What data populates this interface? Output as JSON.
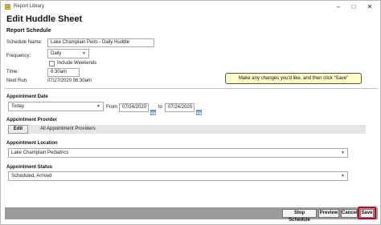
{
  "window": {
    "title": "Report Library"
  },
  "page": {
    "title": "Edit Huddle Sheet",
    "section_title": "Report Schedule"
  },
  "schedule": {
    "name_label": "Schedule Name:",
    "name_value": "Lake Champlain Peds - Daily Huddle",
    "frequency_label": "Frequency:",
    "frequency_value": "Daily",
    "include_weekends_label": "Include Weekends",
    "include_weekends_checked": false,
    "time_label": "Time:",
    "time_value": "6:30am",
    "next_run_label": "Next Run:",
    "next_run_value": "07/27/2020 06:30am"
  },
  "callout": {
    "text": "Make any changes you'd like, and then click “Save”"
  },
  "appointment_date": {
    "label": "Appointment Date",
    "value": "Today",
    "from_label": "From",
    "from_value": "07/24/2020",
    "to_label": "to",
    "to_value": "07/24/2020"
  },
  "appointment_provider": {
    "label": "Appointment Provider",
    "edit_label": "Edit",
    "value": "All Appointment Providers"
  },
  "appointment_location": {
    "label": "Appointment Location",
    "value": "Lake Champlain Pediatrics"
  },
  "appointment_status": {
    "label": "Appointment Status",
    "value": "Scheduled, Arrived"
  },
  "footer": {
    "stop_schedule_label": "Stop Schedule",
    "preview_label": "Preview",
    "cancel_label": "Cancel",
    "save_label": "Save"
  },
  "icons": {
    "app": "report-icon",
    "calendar": "calendar-icon",
    "dropdown": "chevron-down-icon"
  },
  "colors": {
    "callout_bg": "#fffcc4",
    "footer_bg": "#9b9b9b",
    "highlight": "#d0021b",
    "calendar_blue": "#3a78c8"
  }
}
